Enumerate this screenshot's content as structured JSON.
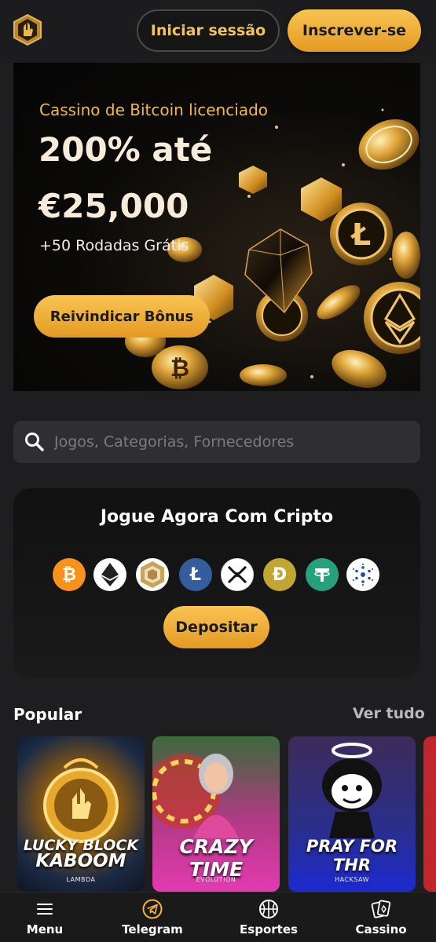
{
  "header": {
    "login_label": "Iniciar sessão",
    "signup_label": "Inscrever-se"
  },
  "banner": {
    "kicker": "Cassino de Bitcoin licenciado",
    "amount_line1": "200% até",
    "amount_line2": "€25,000",
    "spins": "+50 Rodadas Grátis",
    "claim_label": "Reivindicar Bônus"
  },
  "search": {
    "placeholder": "Jogos, Categorias, Fornecedores"
  },
  "crypto": {
    "title": "Jogue Agora Com Cripto",
    "deposit_label": "Depositar",
    "coins": [
      {
        "icon": "bitcoin-icon",
        "color": "#f7931a"
      },
      {
        "icon": "ethereum-icon",
        "color": "#ffffff"
      },
      {
        "icon": "lucky-block-token-icon",
        "color": "#ffffff"
      },
      {
        "icon": "litecoin-icon",
        "color": "#345d9d"
      },
      {
        "icon": "xrp-icon",
        "color": "#ffffff"
      },
      {
        "icon": "dogecoin-icon",
        "color": "#c2a633"
      },
      {
        "icon": "tether-icon",
        "color": "#26a17b"
      },
      {
        "icon": "cardano-icon",
        "color": "#ffffff"
      }
    ]
  },
  "popular": {
    "title": "Popular",
    "see_all": "Ver tudo",
    "games": [
      {
        "title_line1": "LUCKY BLOCK",
        "title_line2": "KABOOM",
        "provider": "LAMBDA"
      },
      {
        "title_line1": "CRAZY TIME",
        "provider": "EVOLUTION"
      },
      {
        "title_line1": "PRAY FOR THR",
        "provider": "HACKSAW"
      }
    ]
  },
  "bottom_nav": {
    "items": [
      {
        "label": "Menu",
        "icon": "hamburger-menu-icon"
      },
      {
        "label": "Telegram",
        "icon": "telegram-icon"
      },
      {
        "label": "Esportes",
        "icon": "basketball-icon"
      },
      {
        "label": "Cassino",
        "icon": "playing-cards-icon"
      }
    ]
  },
  "colors": {
    "accent": "#f3b33d",
    "background": "#1e1e20"
  }
}
